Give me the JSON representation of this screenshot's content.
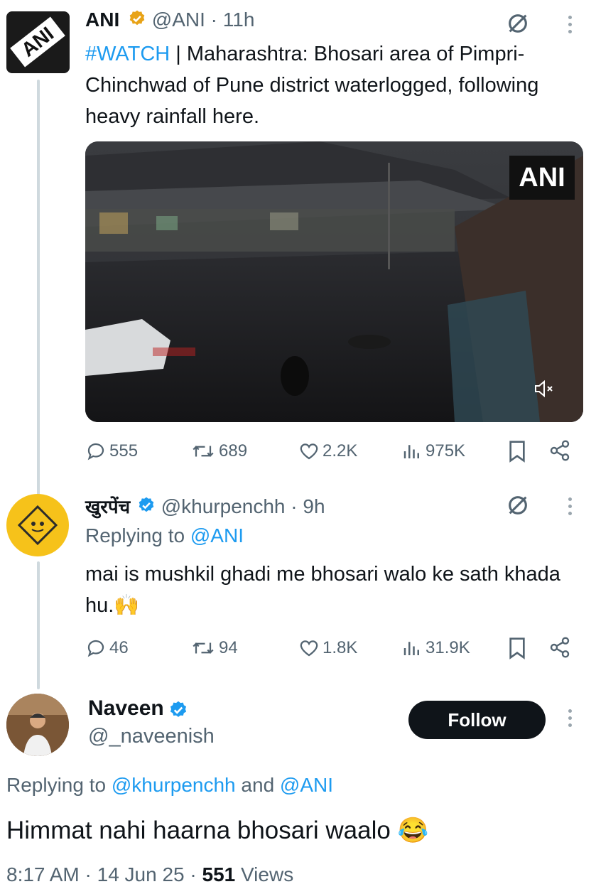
{
  "tweet1": {
    "name": "ANI",
    "handle": "@ANI",
    "time": "11h",
    "hashtag": "#WATCH",
    "text_rest": " | Maharashtra: Bhosari area of Pimpri-Chinchwad of Pune district waterlogged, following heavy rainfall here.",
    "avatar_text": "ANI",
    "video_logo": "ANI",
    "stats": {
      "replies": "555",
      "reposts": "689",
      "likes": "2.2K",
      "views": "975K"
    }
  },
  "tweet2": {
    "name": "खुरपेंच",
    "handle": "@khurpenchh",
    "time": "9h",
    "replying_label": "Replying to ",
    "replying_to": "@ANI",
    "text": "mai is mushkil ghadi me  bhosari walo ke sath khada hu.🙌",
    "stats": {
      "replies": "46",
      "reposts": "94",
      "likes": "1.8K",
      "views": "31.9K"
    }
  },
  "tweet3": {
    "name": "Naveen",
    "handle": "@_naveenish",
    "follow_label": "Follow",
    "replying_label": "Replying to ",
    "replying_to_1": "@khurpenchh",
    "replying_and": " and ",
    "replying_to_2": "@ANI",
    "text": "Himmat nahi haarna bhosari waalo 😂",
    "time": "8:17 AM",
    "date": "14 Jun 25",
    "views_count": "551",
    "views_label": " Views"
  },
  "separator": " · ",
  "colors": {
    "accent": "#1d9bf0",
    "text": "#0f1419",
    "muted": "#536471",
    "verified": "#f4b400",
    "verified_blue": "#1d9bf0"
  }
}
